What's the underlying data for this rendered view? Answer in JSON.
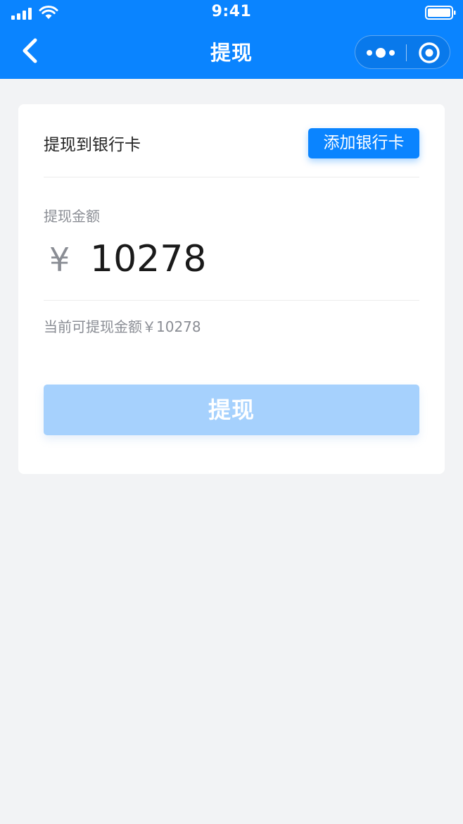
{
  "status_bar": {
    "time": "9:41"
  },
  "nav": {
    "title": "提现"
  },
  "card": {
    "bank_label": "提现到银行卡",
    "add_card_label": "添加银行卡",
    "amount_label": "提现金额",
    "currency_symbol": "¥",
    "amount_value": "10278",
    "available_text": "当前可提现金额￥10278",
    "withdraw_label": "提现"
  },
  "colors": {
    "primary": "#0a84ff",
    "button_disabled": "#a6d1fd",
    "background": "#f2f3f5",
    "secondary_text": "#8a8d94"
  }
}
